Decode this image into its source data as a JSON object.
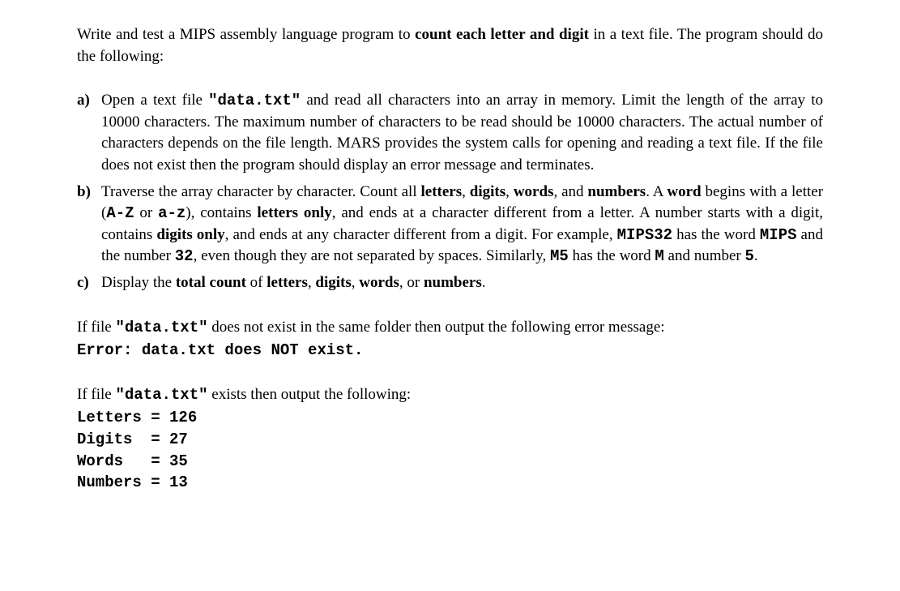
{
  "intro_p1": "Write and test a MIPS assembly language program to ",
  "intro_bold": "count each letter and digit",
  "intro_p2": " in a text file. The program should do the following:",
  "items": {
    "a": {
      "marker": "a)",
      "seg1": "Open a text file ",
      "seg2_mono": "\"data.txt\"",
      "seg3": " and read all characters into an array in memory. Limit the length of the array to 10000 characters. The maximum number of characters to be read should be 10000 characters. The actual number of characters depends on the file length. MARS provides the system calls for opening and reading a text file. If the file does not exist then the program should display an error message and terminates."
    },
    "b": {
      "marker": "b)",
      "seg1": "Traverse the array character by character. Count all ",
      "seg2_bold": "letters",
      "seg3": ", ",
      "seg4_bold": "digits",
      "seg5": ", ",
      "seg6_bold": "words",
      "seg7": ", and ",
      "seg8_bold": "numbers",
      "seg9": ". A ",
      "seg10_bold": "word",
      "seg11": " begins with a letter (",
      "seg12_mono": "A-Z",
      "seg13": " or ",
      "seg14_mono": "a-z",
      "seg15": "), contains ",
      "seg16_bold": "letters only",
      "seg17": ", and ends at a character different from a letter. A number starts with a digit, contains ",
      "seg18_bold": "digits only",
      "seg19": ", and ends at any character different from a digit. For example, ",
      "seg20_mono": "MIPS32",
      "seg21": " has the word ",
      "seg22_mono": "MIPS",
      "seg23": " and the number ",
      "seg24_mono": "32",
      "seg25": ", even though they are not separated by spaces. Similarly, ",
      "seg26_mono": "M5",
      "seg27": " has the word ",
      "seg28_mono": "M",
      "seg29": " and number ",
      "seg30_mono": "5",
      "seg31": "."
    },
    "c": {
      "marker": "c)",
      "seg1": "Display the ",
      "seg2_bold": "total count",
      "seg3": " of ",
      "seg4_bold": "letters",
      "seg5": ", ",
      "seg6_bold": "digits",
      "seg7": ", ",
      "seg8_bold": "words",
      "seg9": ", or ",
      "seg10_bold": "numbers",
      "seg11": "."
    }
  },
  "err_block": {
    "p1": "If file ",
    "p2_mono": "\"data.txt\"",
    "p3": " does not exist in the same folder then output the following error message:",
    "err_line": "Error: data.txt does NOT exist."
  },
  "ok_block": {
    "p1": "If file ",
    "p2_mono": "\"data.txt\"",
    "p3": " exists then output the following:",
    "out": "Letters = 126\nDigits  = 27\nWords   = 35\nNumbers = 13"
  }
}
